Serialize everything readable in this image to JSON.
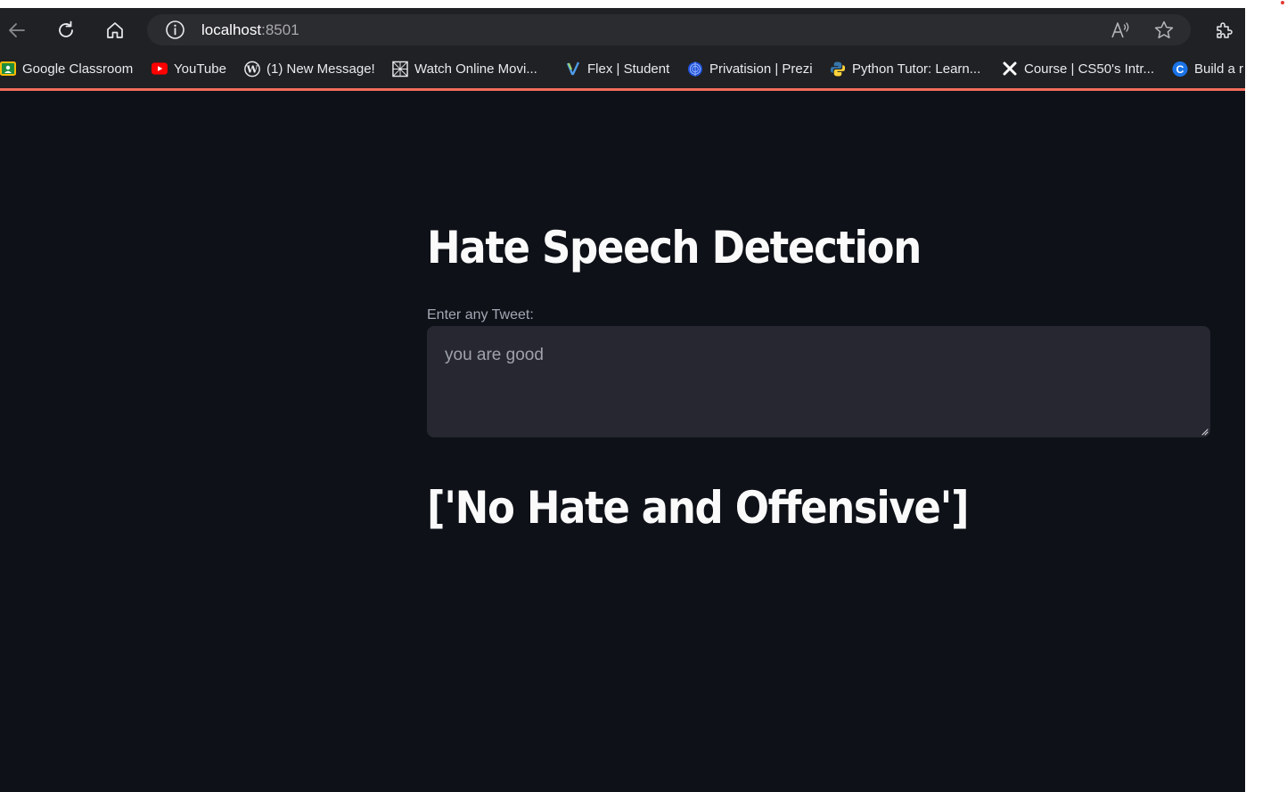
{
  "browser": {
    "address": {
      "host": "localhost",
      "port": ":8501"
    },
    "toolbar_icons": [
      "back-arrow-icon",
      "reload-icon",
      "home-icon",
      "site-info-icon",
      "read-aloud-icon",
      "favorite-star-icon",
      "extensions-icon"
    ],
    "bookmarks": [
      {
        "label": "Google Classroom",
        "icon": "google-classroom-icon"
      },
      {
        "label": "YouTube",
        "icon": "youtube-icon"
      },
      {
        "label": "(1) New Message!",
        "icon": "wordpress-icon"
      },
      {
        "label": "Watch Online Movi...",
        "icon": "movie-site-icon"
      },
      {
        "label": "Flex | Student",
        "icon": "flex-icon"
      },
      {
        "label": "Privatision | Prezi",
        "icon": "prezi-icon"
      },
      {
        "label": "Python Tutor: Learn...",
        "icon": "python-icon"
      },
      {
        "label": "Course | CS50's Intr...",
        "icon": "x-icon"
      },
      {
        "label": "Build a r",
        "icon": "c-icon"
      }
    ],
    "colors": {
      "accent_line": "#f36d5c",
      "chrome_bg": "#202124"
    }
  },
  "app": {
    "title": "Hate Speech Detection",
    "input_label": "Enter any Tweet:",
    "input_value": "you are good",
    "result": "['No Hate and Offensive']",
    "colors": {
      "background": "#0e1117",
      "input_bg": "#262730",
      "text": "#fafafa"
    }
  }
}
